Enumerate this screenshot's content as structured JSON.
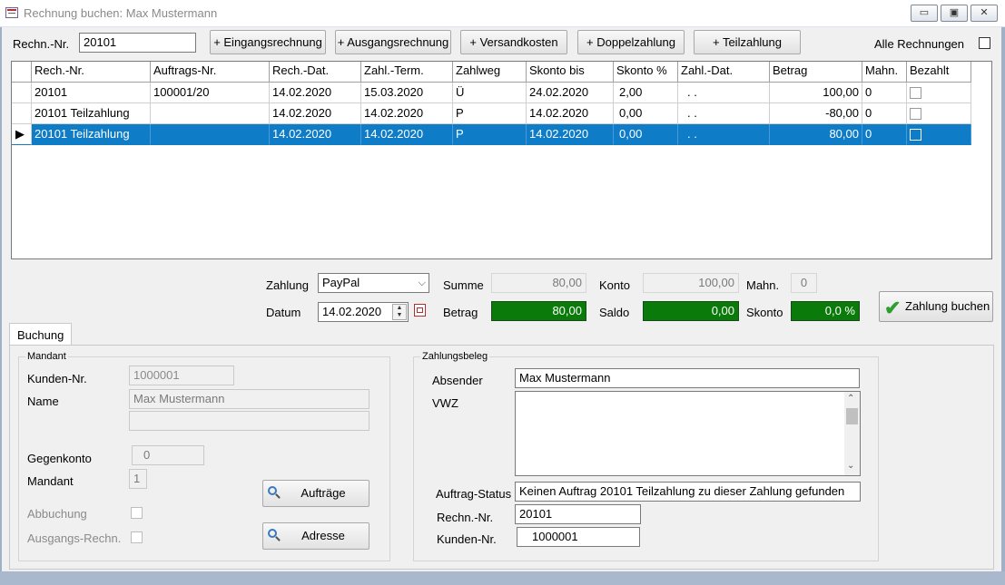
{
  "window": {
    "title": "Rechnung buchen: Max Mustermann",
    "min": "▭",
    "restore": "▣",
    "close": "✕"
  },
  "top": {
    "rechn_label": "Rechn.-Nr.",
    "rechn_value": "20101",
    "buttons": [
      "+ Eingangsrechnung",
      "+ Ausgangsrechnung",
      "+ Versandkosten",
      "+ Doppelzahlung",
      "+ Teilzahlung"
    ],
    "alle_label": "Alle Rechnungen"
  },
  "grid": {
    "headers": [
      "Rech.-Nr.",
      "Auftrags-Nr.",
      "Rech.-Dat.",
      "Zahl.-Term.",
      "Zahlweg",
      "Skonto bis",
      "Skonto %",
      "Zahl.-Dat.",
      "Betrag",
      "Mahn.",
      "Bezahlt"
    ],
    "rows": [
      [
        "20101",
        "100001/20",
        "14.02.2020",
        "15.03.2020",
        "Ü",
        "24.02.2020",
        "2,00",
        " .  .",
        "100,00",
        "0",
        ""
      ],
      [
        "20101 Teilzahlung",
        "",
        "14.02.2020",
        "14.02.2020",
        "P",
        "14.02.2020",
        "0,00",
        " .  .",
        "-80,00",
        "0",
        ""
      ],
      [
        "20101 Teilzahlung",
        "",
        "14.02.2020",
        "14.02.2020",
        "P",
        "14.02.2020",
        "0,00",
        " .  .",
        "80,00",
        "0",
        ""
      ]
    ],
    "selected_row": 2,
    "row_marker": "▶"
  },
  "payment": {
    "zahlung_label": "Zahlung",
    "zahlung_value": "PayPal",
    "datum_label": "Datum",
    "datum_value": "14.02.2020",
    "summe_label": "Summe",
    "summe_value": "80,00",
    "betrag_label": "Betrag",
    "betrag_value": "80,00",
    "konto_label": "Konto",
    "konto_value": "100,00",
    "saldo_label": "Saldo",
    "saldo_value": "0,00",
    "mahn_label": "Mahn.",
    "mahn_value": "0",
    "skonto_label": "Skonto",
    "skonto_value": "0,0 %",
    "buchen_label": "Zahlung buchen"
  },
  "tab": {
    "label": "Buchung"
  },
  "mandant": {
    "legend": "Mandant",
    "kunden_label": "Kunden-Nr.",
    "kunden_value": "1000001",
    "name_label": "Name",
    "name_value": "Max Mustermann",
    "name2_value": "",
    "gegenkonto_label": "Gegenkonto",
    "gegenkonto_value": "0",
    "mandant_label": "Mandant",
    "mandant_value": "1",
    "abbuchung_label": "Abbuchung",
    "ausgangs_label": "Ausgangs-Rechn.",
    "auftraege_btn": "Aufträge",
    "adresse_btn": "Adresse"
  },
  "beleg": {
    "legend": "Zahlungsbeleg",
    "absender_label": "Absender",
    "absender_value": "Max Mustermann",
    "vwz_label": "VWZ",
    "vwz_value": "",
    "status_label": "Auftrag-Status",
    "status_value": "Keinen Auftrag 20101 Teilzahlung zu dieser Zahlung gefunden",
    "rechn_label": "Rechn.-Nr.",
    "rechn_value": "20101",
    "kunden_label": "Kunden-Nr.",
    "kunden_value": "1000001"
  },
  "colors": {
    "selection": "#0f7cc8",
    "green_field": "#0a7a0a"
  }
}
